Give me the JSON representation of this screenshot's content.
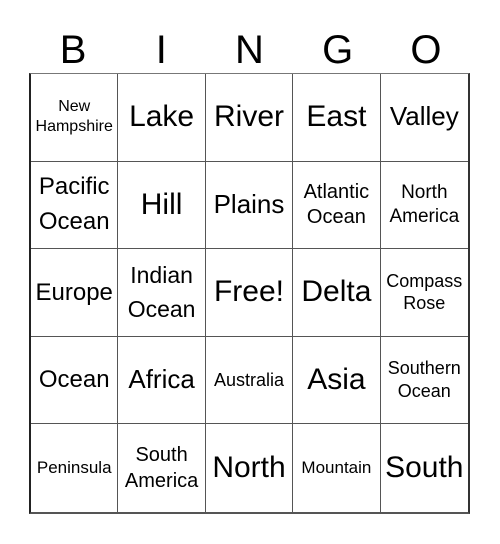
{
  "header": {
    "letters": [
      "B",
      "I",
      "N",
      "G",
      "O"
    ]
  },
  "card": {
    "cells": [
      "New Hampshire",
      "Lake",
      "River",
      "East",
      "Valley",
      "Pacific Ocean",
      "Hill",
      "Plains",
      "Atlantic Ocean",
      "North America",
      "Europe",
      "Indian Ocean",
      "Free!",
      "Delta",
      "Compass Rose",
      "Ocean",
      "Africa",
      "Australia",
      "Asia",
      "Southern Ocean",
      "Peninsula",
      "South America",
      "North",
      "Mountain",
      "South"
    ],
    "free_space": "Free!"
  }
}
